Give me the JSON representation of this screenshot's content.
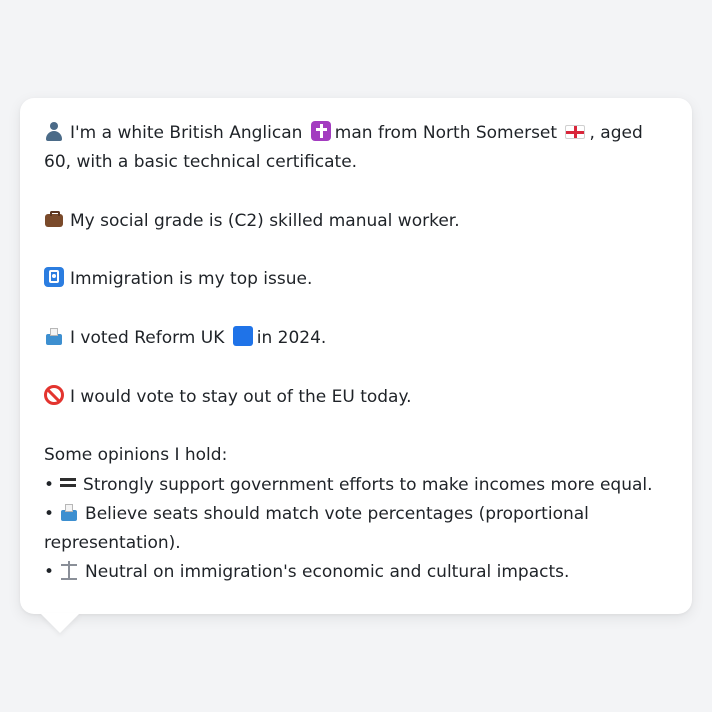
{
  "profile": {
    "intro_text": "I'm a white British Anglican",
    "intro_text_2": "man from North Somerset",
    "intro_text_3": ", aged 60, with a basic technical certificate.",
    "social_grade": "My social grade is (C2) skilled manual worker.",
    "top_issue": "Immigration is my top issue.",
    "vote_2024_a": "I voted Reform UK",
    "vote_2024_b": "in 2024.",
    "eu_vote": "I would vote to stay out of the EU today.",
    "opinions_heading": "Some opinions I hold:",
    "opinions": [
      "Strongly support government efforts to make incomes more equal.",
      "Believe seats should match vote percentages (proportional representation).",
      "Neutral on immigration's economic and cultural impacts."
    ],
    "bullet": "•"
  },
  "icons": {
    "person": "person-icon",
    "cross": "latin-cross-icon",
    "flag": "england-flag-icon",
    "briefcase": "briefcase-icon",
    "passport": "passport-control-icon",
    "ballot": "ballot-box-icon",
    "party_color": "blue-square-icon",
    "eu": "prohibited-icon",
    "equality": "equals-icon",
    "neutral": "balance-scale-icon"
  },
  "colors": {
    "background": "#f3f4f6",
    "card": "#ffffff",
    "text": "#1f2328"
  }
}
